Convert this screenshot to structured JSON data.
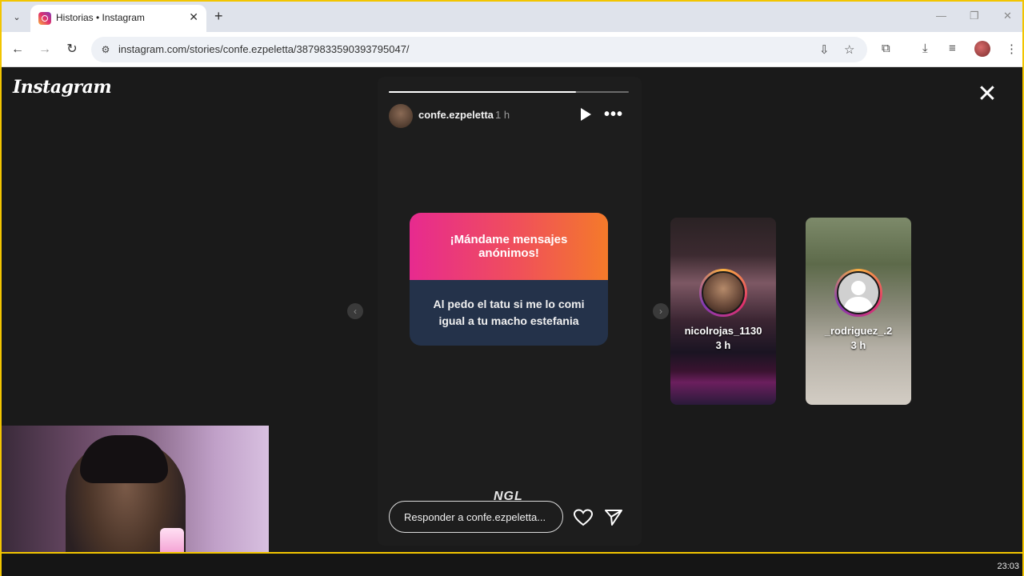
{
  "browser": {
    "tab_title": "Historias • Instagram",
    "url": "instagram.com/stories/confe.ezpeletta/3879833590393795047/"
  },
  "page": {
    "logo": "Instagram"
  },
  "story": {
    "progress": 0.78,
    "author": "confe.ezpeletta",
    "time": "1 h",
    "question_title": "¡Mándame mensajes anónimos!",
    "answer": "Al pedo el tatu si me lo comi igual a tu macho estefania",
    "sticker": "NGL",
    "reply_placeholder": "Responder a confe.ezpeletta..."
  },
  "previews": [
    {
      "username": "nicolrojas_1130",
      "time": "3 h"
    },
    {
      "username": "_rodriguez_.2",
      "time": "3 h"
    }
  ],
  "taskbar": {
    "clock": "23:03"
  }
}
